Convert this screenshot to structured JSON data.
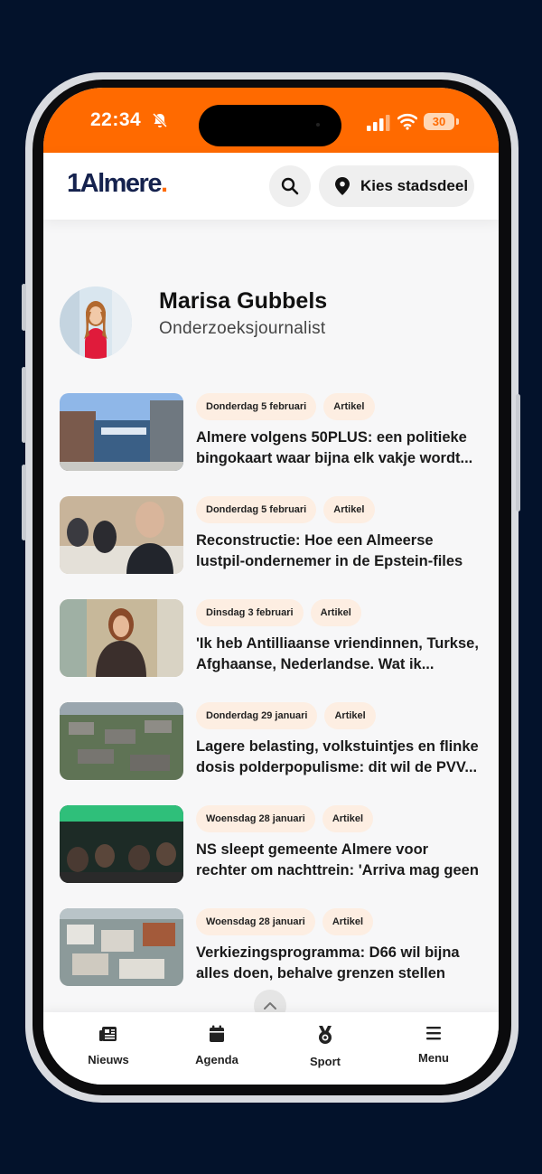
{
  "status_bar": {
    "time": "22:34",
    "battery": "30",
    "accent_color": "#ff6a00"
  },
  "header": {
    "logo": {
      "main": "1Almere",
      "dot": "."
    },
    "district_button_label": "Kies stadsdeel"
  },
  "author": {
    "name": "Marisa Gubbels",
    "role": "Onderzoeksjournalist"
  },
  "articles": [
    {
      "date": "Donderdag 5 februari",
      "type": "Artikel",
      "title": "Almere volgens 50PLUS: een politieke bingokaart waar bijna elk vakje wordt..."
    },
    {
      "date": "Donderdag 5 februari",
      "type": "Artikel",
      "title": "Reconstructie: Hoe een Almeerse lustpil-ondernemer in de Epstein-files terecht..."
    },
    {
      "date": "Dinsdag 3 februari",
      "type": "Artikel",
      "title": "'Ik heb Antilliaanse vriendinnen, Turkse, Afghaanse, Nederlandse. Wat ik..."
    },
    {
      "date": "Donderdag 29 januari",
      "type": "Artikel",
      "title": "Lagere belasting, volkstuintjes en flinke dosis polderpopulisme: dit wil de PVV..."
    },
    {
      "date": "Woensdag 28 januari",
      "type": "Artikel",
      "title": "NS sleept gemeente Almere voor rechter om nachttrein: 'Arriva mag geen subsidi..."
    },
    {
      "date": "Woensdag 28 januari",
      "type": "Artikel",
      "title": "Verkiezingsprogramma: D66 wil bijna alles doen, behalve grenzen stellen"
    }
  ],
  "bottom_nav": [
    {
      "label": "Nieuws",
      "icon": "newspaper-icon"
    },
    {
      "label": "Agenda",
      "icon": "calendar-icon"
    },
    {
      "label": "Sport",
      "icon": "medal-icon"
    },
    {
      "label": "Menu",
      "icon": "hamburger-icon"
    }
  ]
}
